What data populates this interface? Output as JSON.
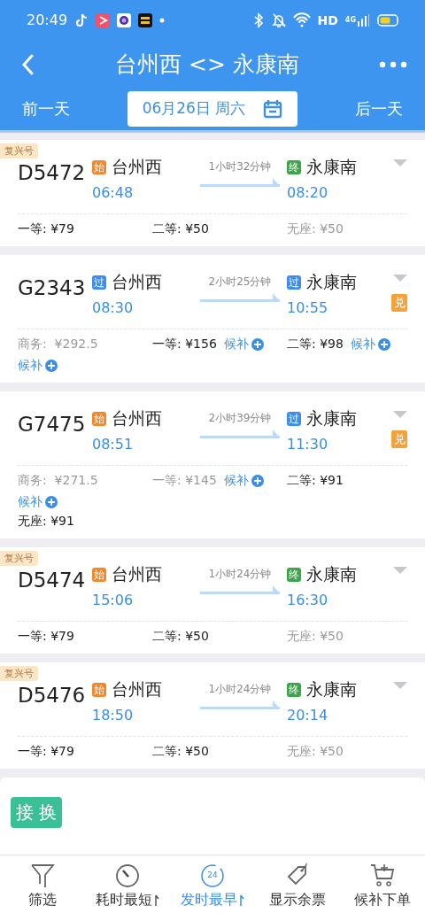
{
  "status_bar": {
    "time": "20:49",
    "network": "HD",
    "signal": "4G"
  },
  "header": {
    "title": "台州西 <> 永康南"
  },
  "date_bar": {
    "prev": "前一天",
    "date": "06月26日 周六",
    "next": "后一天"
  },
  "trains": [
    {
      "badge": "复兴号",
      "number": "D5472",
      "from": {
        "tag": "始",
        "color": "#f5862a",
        "station": "台州西",
        "time": "06:48"
      },
      "duration": "1小时32分钟",
      "to": {
        "tag": "终",
        "color": "#3aa648",
        "station": "永康南",
        "time": "08:20"
      },
      "seats": [
        {
          "text": "一等: ¥79",
          "available": true
        },
        {
          "text": "二等: ¥50",
          "available": true
        },
        {
          "text": "无座: ¥50",
          "available": false
        }
      ]
    },
    {
      "number": "G2343",
      "from": {
        "tag": "过",
        "color": "#3b8ef0",
        "station": "台州西",
        "time": "08:30"
      },
      "duration": "2小时25分钟",
      "to": {
        "tag": "过",
        "color": "#3b8ef0",
        "station": "永康南",
        "time": "10:55"
      },
      "exchange": "兑",
      "seats": [
        {
          "text": "商务:  ¥292.5",
          "available": false,
          "waitlist": "候补"
        },
        {
          "text": "一等: ¥156",
          "available": true,
          "waitlist": "候补"
        },
        {
          "text": "二等: ¥98",
          "available": true,
          "waitlist": "候补"
        }
      ]
    },
    {
      "number": "G7475",
      "from": {
        "tag": "始",
        "color": "#f5862a",
        "station": "台州西",
        "time": "08:51"
      },
      "duration": "2小时39分钟",
      "to": {
        "tag": "过",
        "color": "#3b8ef0",
        "station": "永康南",
        "time": "11:30"
      },
      "exchange": "兑",
      "seats": [
        {
          "text": "商务:  ¥271.5",
          "available": false,
          "waitlist": "候补"
        },
        {
          "text": "一等: ¥145",
          "available": false,
          "waitlist": "候补"
        },
        {
          "text": "二等: ¥91",
          "available": true
        },
        {
          "text": "无座: ¥91",
          "available": true
        }
      ]
    },
    {
      "badge": "复兴号",
      "number": "D5474",
      "from": {
        "tag": "始",
        "color": "#f5862a",
        "station": "台州西",
        "time": "15:06"
      },
      "duration": "1小时24分钟",
      "to": {
        "tag": "终",
        "color": "#3aa648",
        "station": "永康南",
        "time": "16:30"
      },
      "seats": [
        {
          "text": "一等: ¥79",
          "available": true
        },
        {
          "text": "二等: ¥50",
          "available": true
        },
        {
          "text": "无座: ¥50",
          "available": false
        }
      ]
    },
    {
      "badge": "复兴号",
      "number": "D5476",
      "from": {
        "tag": "始",
        "color": "#f5862a",
        "station": "台州西",
        "time": "18:50"
      },
      "duration": "1小时24分钟",
      "to": {
        "tag": "终",
        "color": "#3aa648",
        "station": "永康南",
        "time": "20:14"
      },
      "seats": [
        {
          "text": "一等: ¥79",
          "available": true
        },
        {
          "text": "二等: ¥50",
          "available": true
        },
        {
          "text": "无座: ¥50",
          "available": false
        }
      ]
    }
  ],
  "transfer": {
    "badge": "接 换"
  },
  "bottom_bar": [
    {
      "kind": "filter",
      "label": "筛选",
      "selected": false
    },
    {
      "kind": "timer",
      "label": "耗时最短",
      "selected": false,
      "sortable": true
    },
    {
      "kind": "clock",
      "label": "发时最早",
      "icon_text": "24",
      "selected": true,
      "sortable": true
    },
    {
      "kind": "tag",
      "label": "显示余票",
      "selected": false
    },
    {
      "kind": "cart",
      "label": "候补下单",
      "selected": false
    }
  ]
}
